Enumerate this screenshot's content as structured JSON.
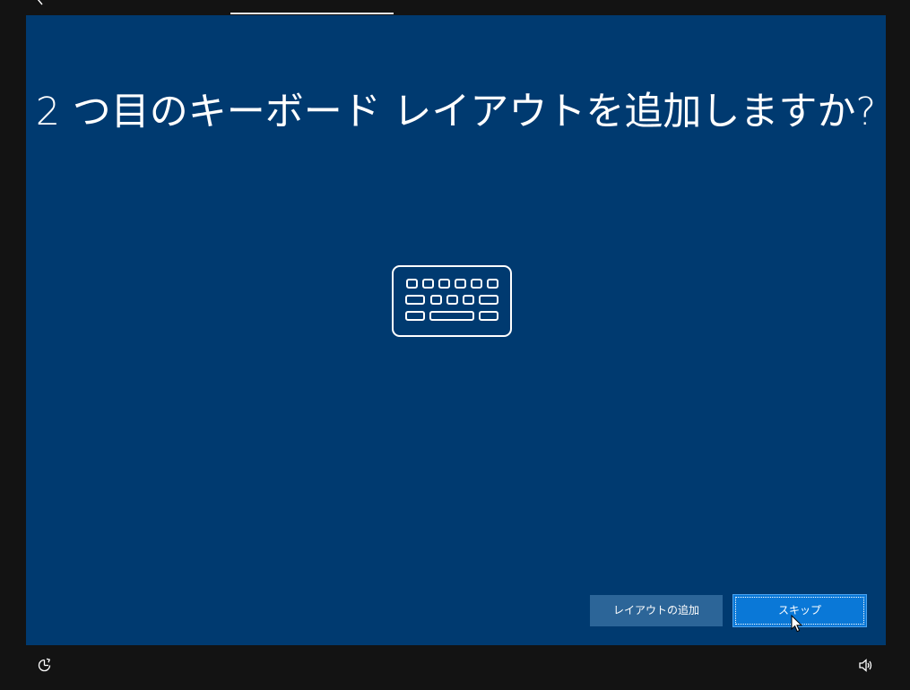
{
  "top_bar": {
    "back_icon": "chevron-left-icon",
    "active_tab_label": ""
  },
  "page": {
    "title": "2 つ目のキーボード レイアウトを追加しますか?",
    "illustration_icon": "keyboard-icon"
  },
  "actions": {
    "add_layout_label": "レイアウトの追加",
    "skip_label": "スキップ"
  },
  "bottom_bar": {
    "left_icon": "ease-of-access-icon",
    "right_icon": "volume-icon"
  },
  "colors": {
    "background": "#131313",
    "panel": "#003a70",
    "secondary_button": "#2c6598",
    "primary_button": "#0a78d7"
  }
}
